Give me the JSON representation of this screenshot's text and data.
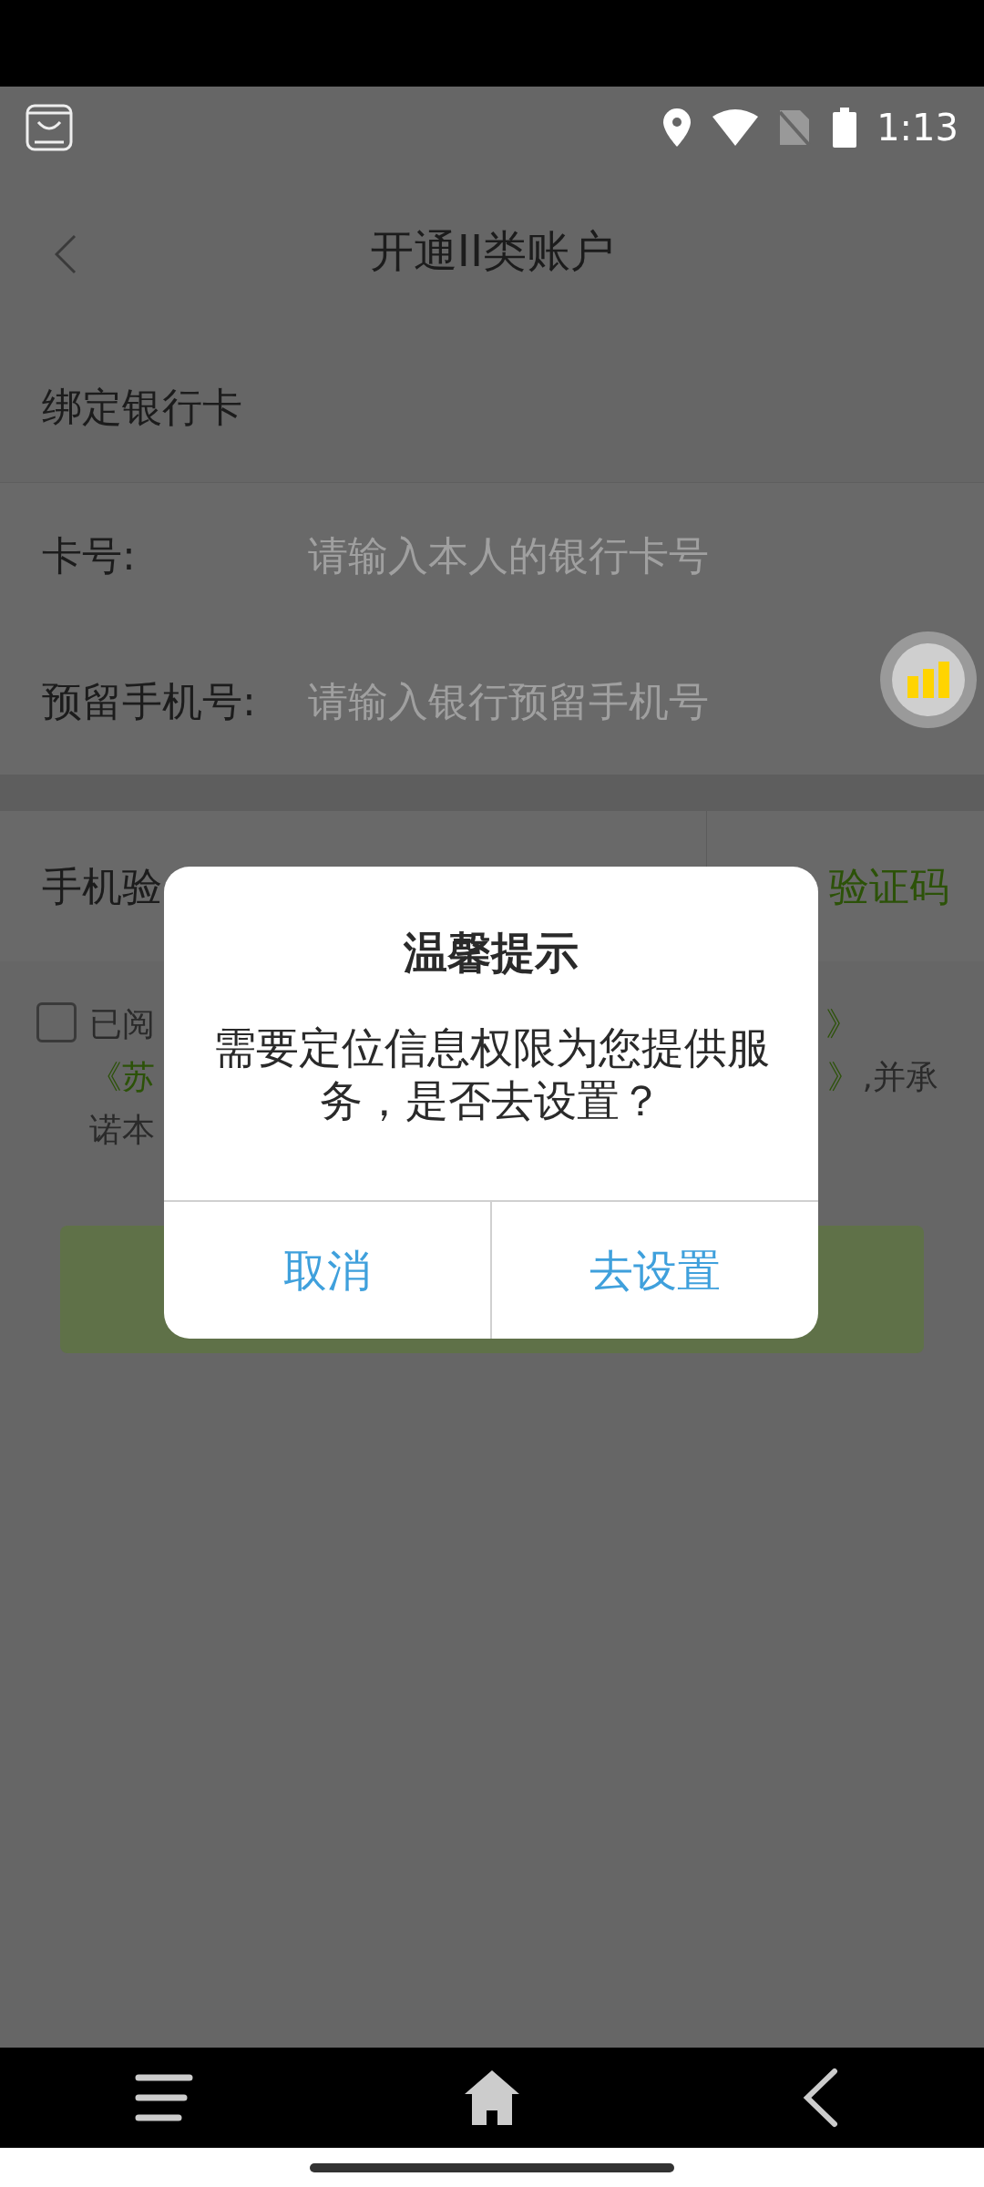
{
  "status_bar": {
    "time": "1:13"
  },
  "header": {
    "title": "开通II类账户"
  },
  "section_title": "绑定银行卡",
  "fields": [
    {
      "label": "卡号:",
      "placeholder": "请输入本人的银行卡号"
    },
    {
      "label": "预留手机号:",
      "placeholder": "请输入银行预留手机号"
    }
  ],
  "code_row": {
    "label": "手机验",
    "button": "验证码"
  },
  "agreement": {
    "checked": false,
    "line_1_left": "已阅",
    "line_1_right": "》",
    "line_2_left": "《苏",
    "line_2_right_link": "》",
    "line_2_right": ",并承",
    "line_3_left": "诺本"
  },
  "dialog": {
    "title": "温馨提示",
    "message": "需要定位信息权限为您提供服务，是否去设置？",
    "buttons": [
      "取消",
      "去设置"
    ]
  }
}
